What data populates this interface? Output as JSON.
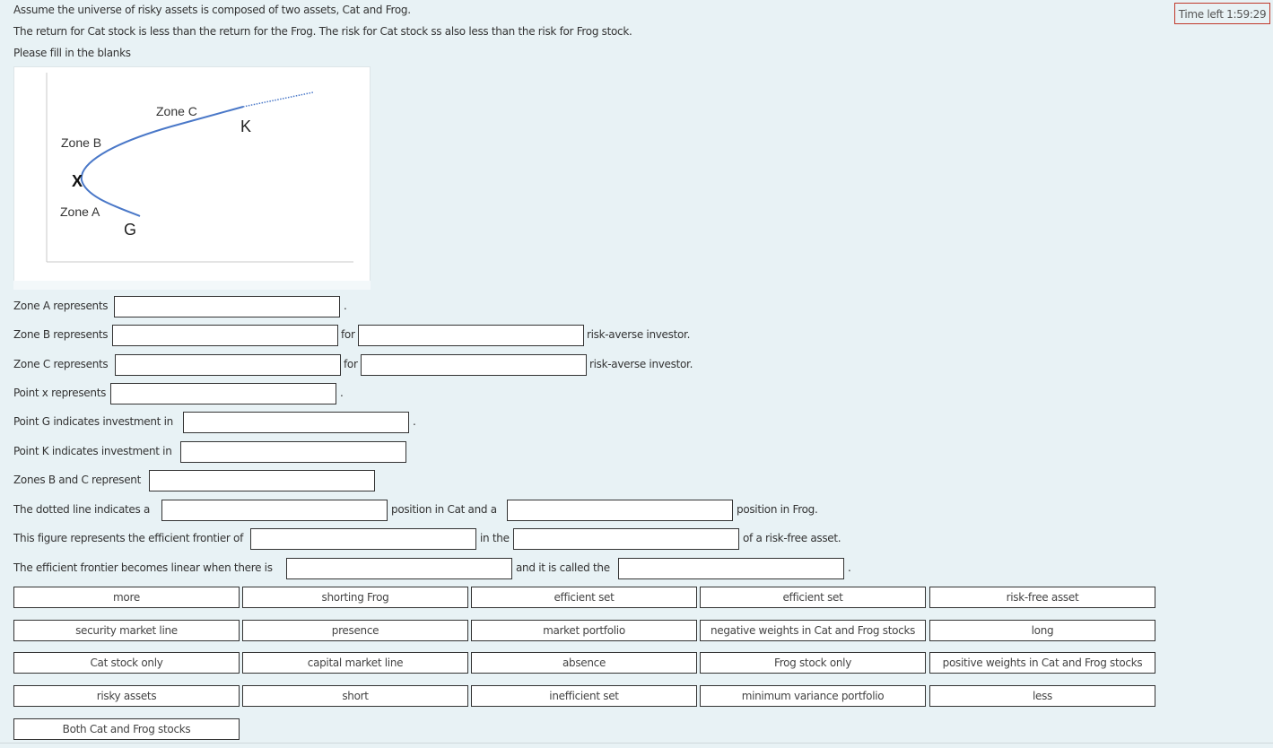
{
  "timer": {
    "label": "Time left 1:59:29"
  },
  "intro": {
    "line1": "Assume the universe of risky assets is composed of two assets, Cat and Frog.",
    "line2": "The return for Cat stock is less than the return for the Frog. The risk for Cat stock ss also less than the risk for Frog stock.",
    "line3": "Please fill in the blanks"
  },
  "figure": {
    "labels": {
      "zone_a": "Zone A",
      "zone_b": "Zone B",
      "zone_c": "Zone C",
      "point_x": "X",
      "point_g": "G",
      "point_k": "K"
    },
    "curve_color": "#4a78c8"
  },
  "questions": {
    "q1": {
      "prefix": "Zone A represents",
      "suffix": "."
    },
    "q2": {
      "prefix": "Zone B represents",
      "mid": "for",
      "suffix": "risk-averse investor."
    },
    "q3": {
      "prefix": "Zone C represents",
      "mid": "for",
      "suffix": "risk-averse investor."
    },
    "q4": {
      "prefix": "Point x represents",
      "suffix": "."
    },
    "q5": {
      "prefix": "Point G indicates investment in",
      "suffix": "."
    },
    "q6": {
      "prefix": "Point K indicates investment in"
    },
    "q7": {
      "prefix": "Zones B and C represent"
    },
    "q8": {
      "prefix": "The dotted line indicates a",
      "mid": "position in Cat and a",
      "suffix": "position in Frog."
    },
    "q9": {
      "prefix": "This figure represents the efficient frontier of",
      "mid": "in the",
      "suffix": "of a risk-free asset."
    },
    "q10": {
      "prefix": "The efficient frontier becomes linear when there is",
      "mid": "and it is called the",
      "suffix": "."
    }
  },
  "answer_bank": [
    "more",
    "shorting Frog",
    "efficient set",
    "efficient set",
    "risk-free asset",
    "security market line",
    "presence",
    "market portfolio",
    "negative weights in Cat and Frog stocks",
    "long",
    "Cat stock only",
    "capital market line",
    "absence",
    "Frog stock only",
    "positive weights in Cat and Frog stocks",
    "risky assets",
    "short",
    "inefficient set",
    "minimum variance portfolio",
    "less",
    "Both Cat and Frog stocks"
  ]
}
